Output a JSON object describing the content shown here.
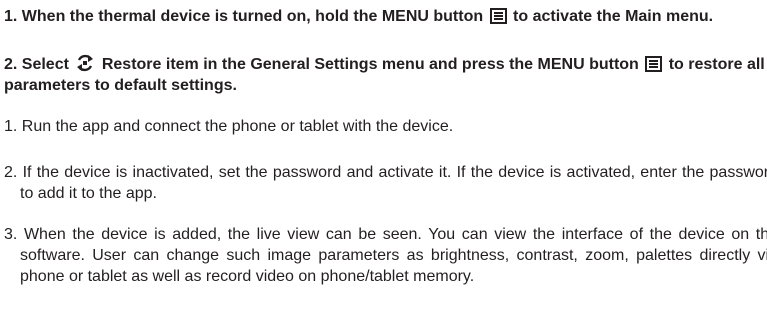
{
  "instructions": {
    "step1_a": "1. When the thermal device is turned on, hold the MENU button",
    "step1_b": "to activate the Main menu.",
    "step2_a": "2. Select",
    "step2_b": "Restore item in the General Settings menu and press the MENU button",
    "step2_c": "to restore all parameters to default settings.",
    "app_step1": "1. Run the app and connect the phone or tablet with the device.",
    "app_step2": "2. If the device is inactivated, set the password and activate it. If the device is activated, enter the password to add it to the app.",
    "app_step3": "3. When the device is added, the live view can be seen. You can view the interface of the device on the software. User can change such image parameters as brightness, contrast, zoom, palettes directly via phone or tablet as well as record video on phone/tablet memory."
  },
  "icons": {
    "menu": "menu-icon",
    "restore": "restore-icon"
  }
}
